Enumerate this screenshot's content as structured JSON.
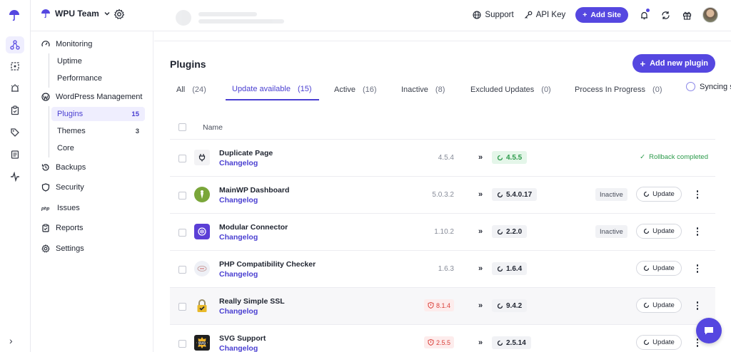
{
  "colors": {
    "accent": "#5547e0",
    "success": "#2b9a4a",
    "danger": "#d9403a"
  },
  "topbar": {
    "team_name": "WPU Team",
    "support_label": "Support",
    "api_key_label": "API Key",
    "add_site_label": "Add Site"
  },
  "sidebar": {
    "monitoring": "Monitoring",
    "uptime": "Uptime",
    "performance": "Performance",
    "wp_management": "WordPress Management",
    "plugins": {
      "label": "Plugins",
      "count": "15"
    },
    "themes": {
      "label": "Themes",
      "count": "3"
    },
    "core": "Core",
    "backups": "Backups",
    "security": "Security",
    "issues": "Issues",
    "reports": "Reports",
    "settings": "Settings"
  },
  "main": {
    "title": "Plugins",
    "add_plugin_label": "Add new plugin",
    "tabs": [
      {
        "label": "All",
        "count": "(24)"
      },
      {
        "label": "Update available",
        "count": "(15)"
      },
      {
        "label": "Active",
        "count": "(16)"
      },
      {
        "label": "Inactive",
        "count": "(8)"
      },
      {
        "label": "Excluded Updates",
        "count": "(0)"
      },
      {
        "label": "Process In Progress",
        "count": "(0)"
      }
    ],
    "syncing_label": "Syncing site",
    "column_name": "Name",
    "changelog_label": "Changelog",
    "update_label": "Update",
    "inactive_label": "Inactive",
    "rollback_label": "Rollback completed",
    "rows": [
      {
        "name": "Duplicate Page",
        "old": "4.5.4",
        "new": "4.5.5"
      },
      {
        "name": "MainWP Dashboard",
        "old": "5.0.3.2",
        "new": "5.4.0.17"
      },
      {
        "name": "Modular Connector",
        "old": "1.10.2",
        "new": "2.2.0"
      },
      {
        "name": "PHP Compatibility Checker",
        "old": "1.6.3",
        "new": "1.6.4"
      },
      {
        "name": "Really Simple SSL",
        "old": "8.1.4",
        "new": "9.4.2"
      },
      {
        "name": "SVG Support",
        "old": "2.5.5",
        "new": "2.5.14"
      }
    ]
  }
}
